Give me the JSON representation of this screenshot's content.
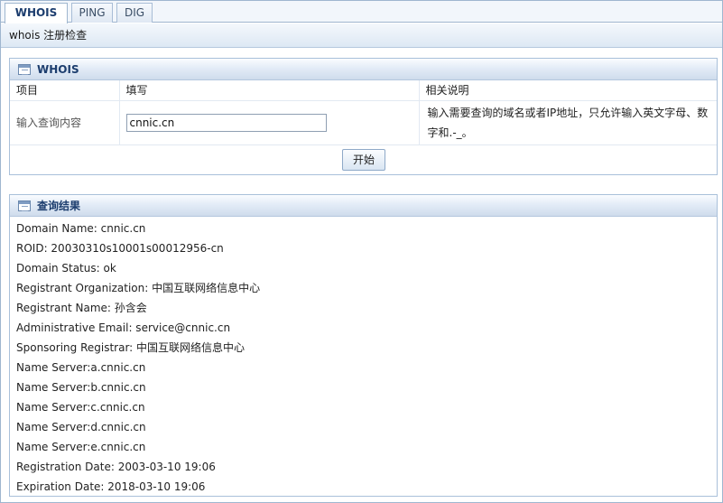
{
  "tabs": [
    {
      "label": "WHOIS",
      "active": true
    },
    {
      "label": "PING",
      "active": false
    },
    {
      "label": "DIG",
      "active": false
    }
  ],
  "subtitle": "whois 注册检查",
  "whois_panel": {
    "title": "WHOIS",
    "headers": {
      "item": "项目",
      "fill": "填写",
      "desc": "相关说明"
    },
    "row": {
      "label": "输入查询内容",
      "value": "cnnic.cn",
      "desc": "输入需要查询的域名或者IP地址，只允许输入英文字母、数字和.-_。"
    },
    "start_button": "开始"
  },
  "results_panel": {
    "title": "查询结果",
    "lines": [
      "Domain Name: cnnic.cn",
      "ROID: 20030310s10001s00012956-cn",
      "Domain Status: ok",
      "Registrant Organization: 中国互联网络信息中心",
      "Registrant Name: 孙含会",
      "Administrative Email: service@cnnic.cn",
      "Sponsoring Registrar: 中国互联网络信息中心",
      "Name Server:a.cnnic.cn",
      "Name Server:b.cnnic.cn",
      "Name Server:c.cnnic.cn",
      "Name Server:d.cnnic.cn",
      "Name Server:e.cnnic.cn",
      "Registration Date: 2003-03-10 19:06",
      "Expiration Date: 2018-03-10 19:06"
    ]
  },
  "colors": {
    "border": "#9fb6cf",
    "header_text": "#1c3d6e",
    "panel_gradient_end": "#cfdcec"
  }
}
